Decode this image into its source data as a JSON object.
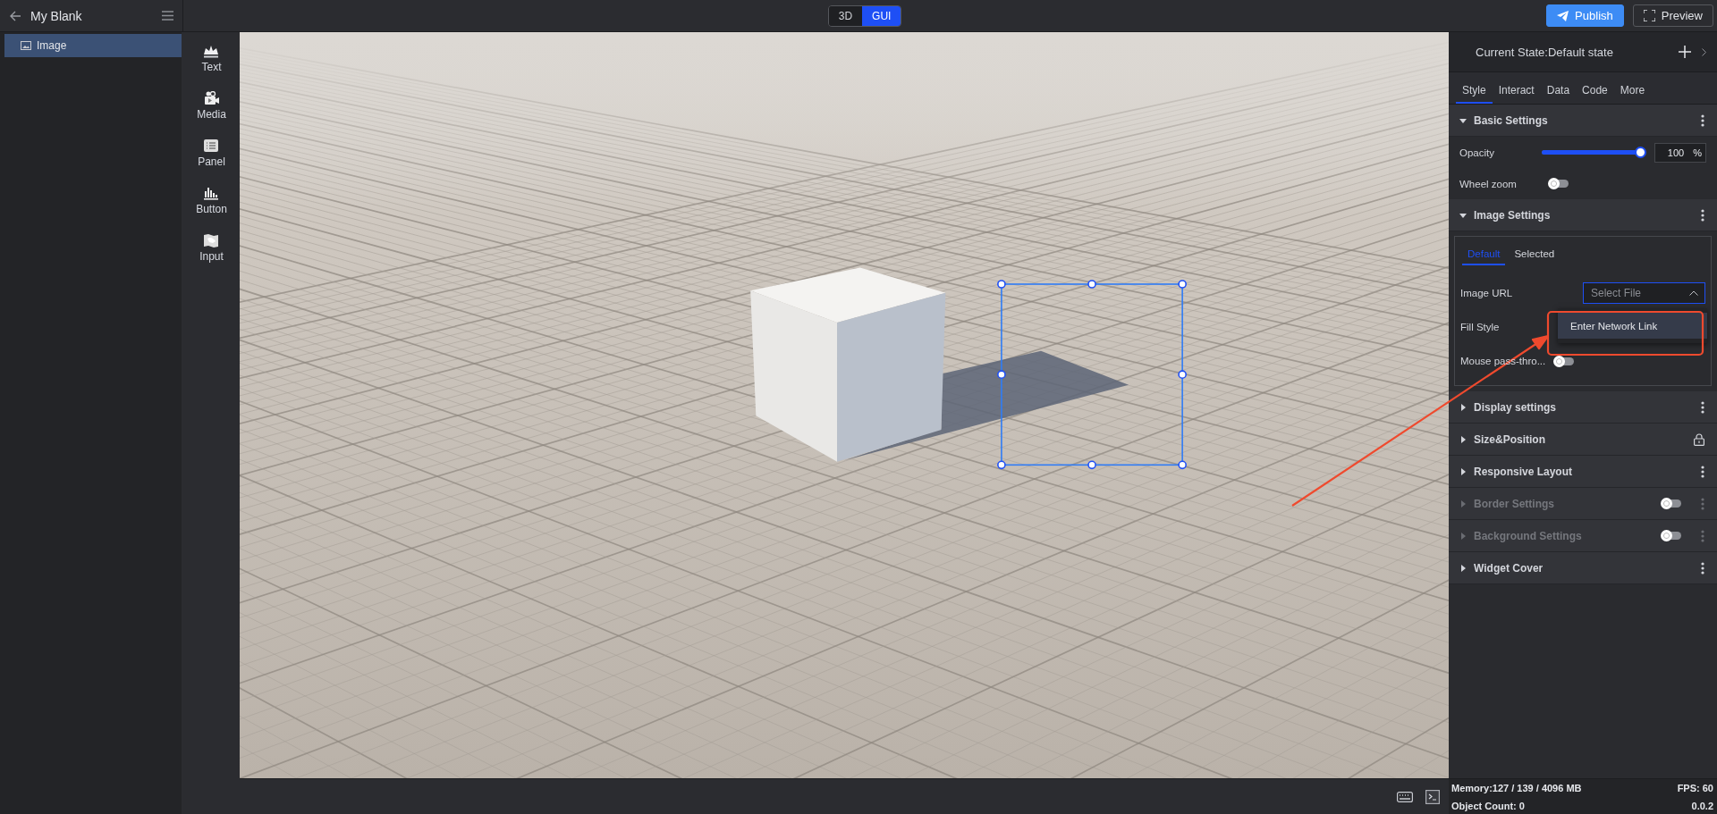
{
  "project": {
    "title": "My Blank"
  },
  "layers": [
    {
      "label": "Image",
      "selected": true
    }
  ],
  "widgets": [
    {
      "label": "Text",
      "kind": "text"
    },
    {
      "label": "Media",
      "kind": "media"
    },
    {
      "label": "Panel",
      "kind": "panel"
    },
    {
      "label": "Button",
      "kind": "button"
    },
    {
      "label": "Input",
      "kind": "input"
    }
  ],
  "mode_toggle": [
    {
      "label": "3D",
      "selected": false
    },
    {
      "label": "GUI",
      "selected": true
    }
  ],
  "actions": [
    {
      "label": "Publish",
      "kind": "publish"
    },
    {
      "label": "Preview",
      "kind": "preview"
    }
  ],
  "inspector": {
    "state": "Current State:Default state",
    "tabs": [
      {
        "label": "Style",
        "selected": true
      },
      {
        "label": "Interact",
        "selected": false
      },
      {
        "label": "Data",
        "selected": false
      },
      {
        "label": "Code",
        "selected": false
      },
      {
        "label": "More",
        "selected": false
      }
    ],
    "sections": [
      {
        "title": "Basic Settings",
        "expanded": true,
        "disabled": false,
        "kind": "menu",
        "rows": [
          {
            "kind": "slider",
            "label": "Opacity",
            "level": 1,
            "value": "100",
            "unit": "%"
          },
          {
            "kind": "toggle",
            "label": "Wheel zoom",
            "on": false
          }
        ]
      },
      {
        "title": "Image Settings",
        "expanded": true,
        "disabled": false,
        "kind": "menu",
        "subtabs": [
          {
            "label": "Default",
            "selected": true
          },
          {
            "label": "Selected",
            "selected": false
          }
        ],
        "rows": [
          {
            "kind": "select",
            "label": "Image URL",
            "placeholder": "Select File",
            "open": true,
            "options": [
              {
                "label": "Enter Network Link",
                "highlighted": true
              }
            ]
          },
          {
            "kind": "plain",
            "label": "Fill Style"
          },
          {
            "kind": "toggle",
            "label": "Mouse pass-thro...",
            "on": false
          }
        ]
      },
      {
        "title": "Display settings",
        "expanded": false,
        "disabled": false,
        "kind": "menu"
      },
      {
        "title": "Size&Position",
        "expanded": false,
        "disabled": false,
        "kind": "lock"
      },
      {
        "title": "Responsive Layout",
        "expanded": false,
        "disabled": false,
        "kind": "menu"
      },
      {
        "title": "Border Settings",
        "expanded": false,
        "disabled": true,
        "kind": "menu",
        "switch": {
          "on": false
        }
      },
      {
        "title": "Background Settings",
        "expanded": false,
        "disabled": true,
        "kind": "menu",
        "switch": {
          "on": false
        }
      },
      {
        "title": "Widget Cover",
        "expanded": false,
        "disabled": false,
        "kind": "menu"
      }
    ]
  },
  "status": {
    "memory": "Memory:127 / 139 / 4096 MB",
    "fps": "FPS: 60",
    "object_count": "Object Count: 0",
    "version": "0.0.2"
  }
}
